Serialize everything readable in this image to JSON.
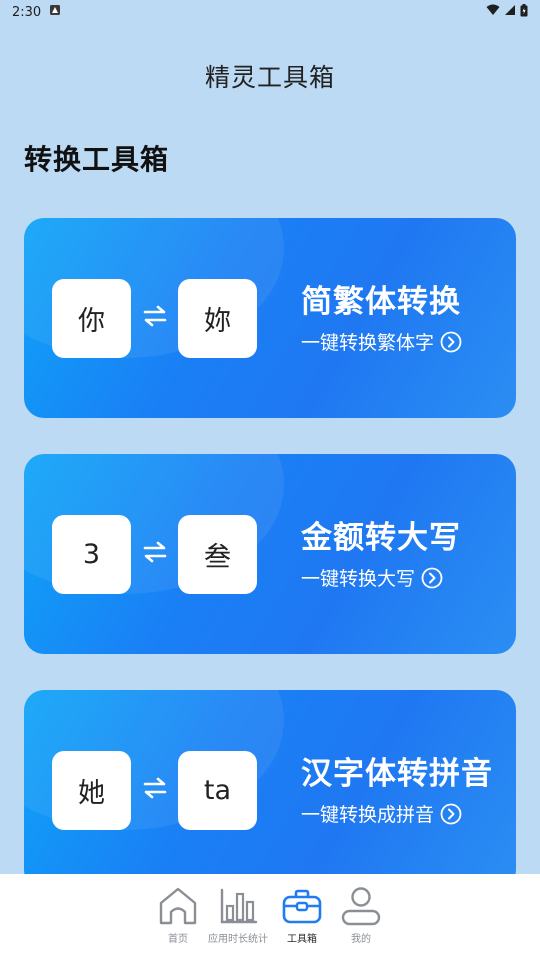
{
  "status_bar": {
    "time": "2:30"
  },
  "header": {
    "title": "精灵工具箱"
  },
  "section": {
    "title": "转换工具箱"
  },
  "cards": [
    {
      "left_char": "你",
      "right_char": "妳",
      "title": "简繁体转换",
      "subtitle": "一键转换繁体字"
    },
    {
      "left_char": "3",
      "right_char": "叁",
      "title": "金额转大写",
      "subtitle": "一键转换大写"
    },
    {
      "left_char": "她",
      "right_char": "ta",
      "title": "汉字体转拼音",
      "subtitle": "一键转换成拼音"
    }
  ],
  "bottom_nav": {
    "items": [
      {
        "label": "首页",
        "icon": "home-icon"
      },
      {
        "label": "应用时长统计",
        "icon": "bar-chart-icon"
      },
      {
        "label": "工具箱",
        "icon": "toolbox-icon",
        "active": true
      },
      {
        "label": "我的",
        "icon": "person-icon"
      }
    ]
  },
  "colors": {
    "background": "#bcdaf4",
    "card_gradient_start": "#0ea4f8",
    "card_gradient_end": "#1f78f2",
    "nav_active": "#1f7cf2",
    "nav_inactive": "#8a8f96"
  }
}
